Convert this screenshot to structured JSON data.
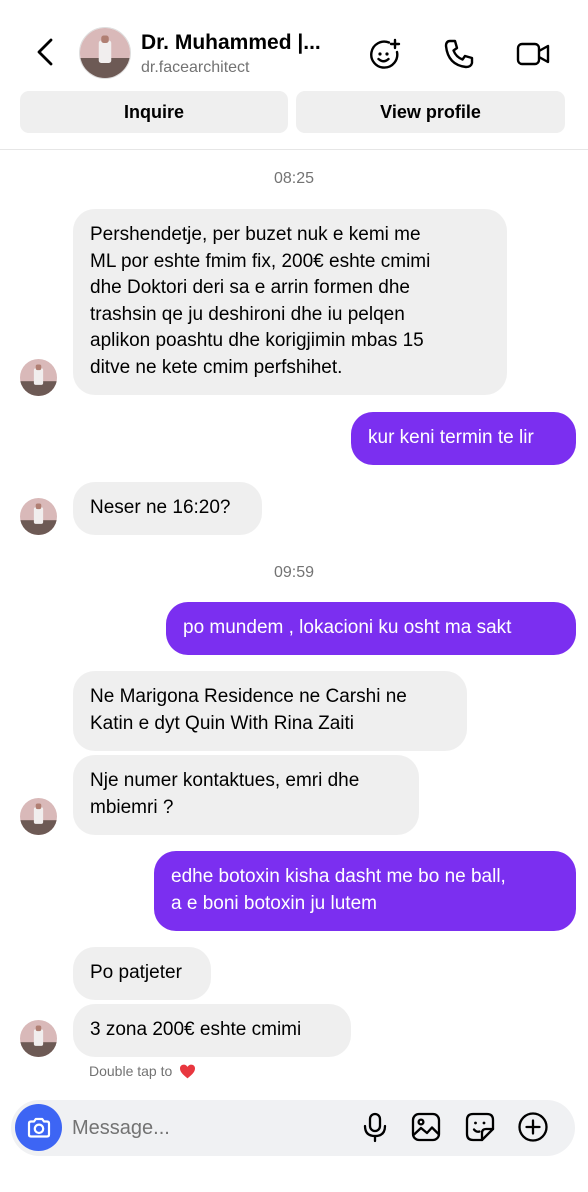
{
  "header": {
    "title": "Dr. Muhammed |...",
    "username": "dr.facearchitect",
    "icons": [
      "back-chevron-icon",
      "effects-icon",
      "phone-icon",
      "video-camera-icon"
    ]
  },
  "actions": {
    "inquire_label": "Inquire",
    "view_profile_label": "View profile"
  },
  "conversation": {
    "timestamp_1": "08:25",
    "timestamp_2": "09:59",
    "messages": [
      {
        "sender": "them",
        "lines": [
          "Pershendetje, per buzet nuk e kemi me",
          "ML por eshte fmim fix, 200€ eshte cmimi",
          "dhe Doktori deri sa e arrin formen dhe",
          "trashsin qe ju deshironi dhe iu pelqen",
          "aplikon poashtu dhe korigjimin mbas 15",
          "ditve ne kete cmim perfshihet."
        ]
      },
      {
        "sender": "me",
        "lines": [
          "kur keni termin te lir"
        ]
      },
      {
        "sender": "them",
        "lines": [
          "Neser ne 16:20?"
        ]
      },
      {
        "sender": "me",
        "lines": [
          "po mundem , lokacioni ku osht ma sakt"
        ]
      },
      {
        "sender": "them",
        "lines": [
          "Ne Marigona Residence ne Carshi ne",
          "Katin e dyt Quin With Rina Zaiti"
        ]
      },
      {
        "sender": "them",
        "lines": [
          "Nje numer kontaktues, emri dhe",
          "mbiemri ?"
        ]
      },
      {
        "sender": "me",
        "lines": [
          "edhe botoxin kisha dasht me bo ne ball,",
          "a e boni botoxin ju lutem"
        ]
      },
      {
        "sender": "them",
        "lines": [
          "Po patjeter"
        ]
      },
      {
        "sender": "them",
        "lines": [
          "3 zona 200€ eshte cmimi"
        ]
      }
    ],
    "double_tap_hint": "Double tap to"
  },
  "composer": {
    "placeholder": "Message...",
    "icons": [
      "camera-icon",
      "microphone-icon",
      "gallery-icon",
      "sticker-icon",
      "add-icon"
    ]
  },
  "colors": {
    "outgoing_bubble": "#7b2ff0",
    "incoming_bubble": "#efefef",
    "camera_button": "#3d65f4",
    "secondary_text": "#737373",
    "heart": "#e8373f"
  }
}
